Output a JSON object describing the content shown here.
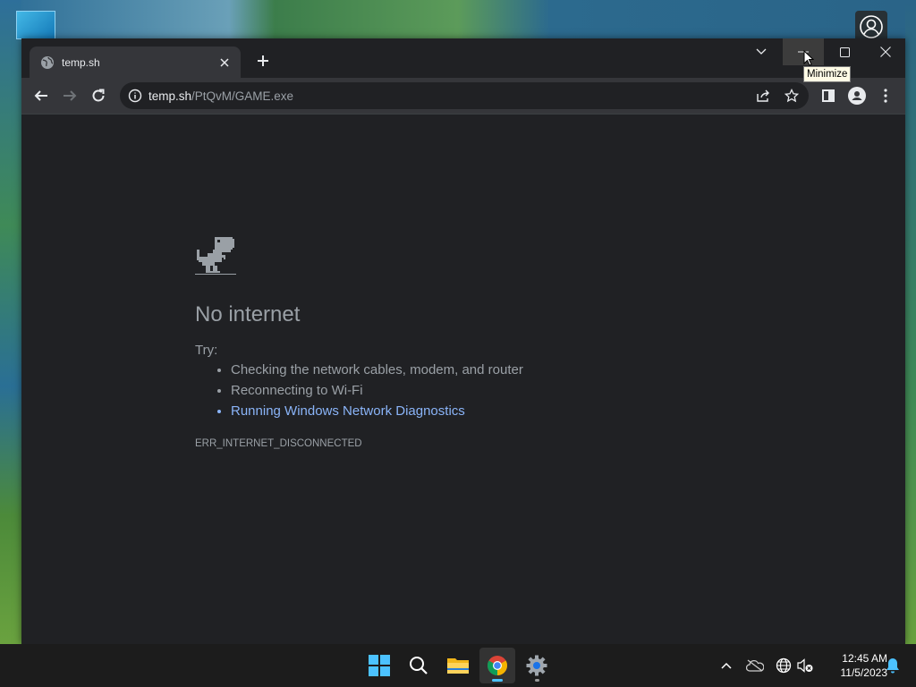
{
  "tab": {
    "title": "temp.sh"
  },
  "address": {
    "host": "temp.sh",
    "path": "/PtQvM/GAME.exe"
  },
  "tooltip": {
    "text": "Minimize"
  },
  "error_page": {
    "title": "No internet",
    "try_label": "Try:",
    "suggestions": [
      "Checking the network cables, modem, and router",
      "Reconnecting to Wi-Fi",
      "Running Windows Network Diagnostics"
    ],
    "error_code": "ERR_INTERNET_DISCONNECTED"
  },
  "clock": {
    "time": "12:45 AM",
    "date": "11/5/2023"
  },
  "colors": {
    "link": "#8ab4f8",
    "page_bg": "#202124",
    "toolbar_bg": "#35363a",
    "active_indicator": "#4cc2ff"
  }
}
